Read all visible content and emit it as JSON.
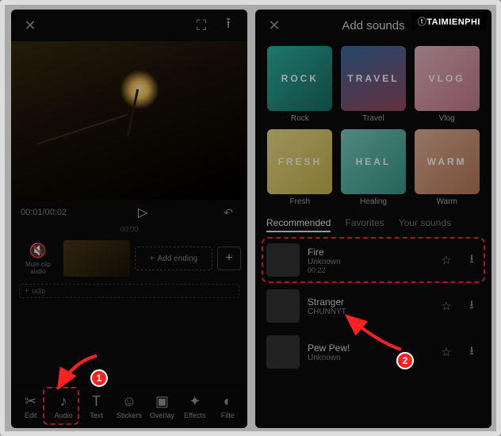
{
  "logo": "TAIMIENPHI",
  "badges": {
    "b1": "1",
    "b2": "2"
  },
  "left": {
    "time_current": "00:01",
    "time_total": "00:02",
    "ruler": "00:00",
    "mute_label": "Mute clip audio",
    "add_ending": "Add ending",
    "audline": "udio",
    "tools": {
      "edit": "Edit",
      "audio": "Audio",
      "text": "Text",
      "stickers": "Stickers",
      "overlay": "Overlay",
      "effects": "Effects",
      "filter": "Filte"
    }
  },
  "right": {
    "title": "Add sounds",
    "cats": [
      {
        "name": "Rock",
        "txt": "ROCK"
      },
      {
        "name": "Travel",
        "txt": "TRAVEL"
      },
      {
        "name": "Vlog",
        "txt": "VLOG"
      },
      {
        "name": "Fresh",
        "txt": "FRESH"
      },
      {
        "name": "Healing",
        "txt": "HEAL"
      },
      {
        "name": "Warm",
        "txt": "WARM"
      }
    ],
    "tabs": {
      "rec": "Recommended",
      "fav": "Favorites",
      "your": "Your sounds"
    },
    "songs": [
      {
        "name": "Fire",
        "by": "Unknown",
        "dur": "00:22"
      },
      {
        "name": "Stranger",
        "by": "CHUNNYT",
        "dur": ""
      },
      {
        "name": "Pew Pew!",
        "by": "Unknown",
        "dur": ""
      }
    ]
  }
}
